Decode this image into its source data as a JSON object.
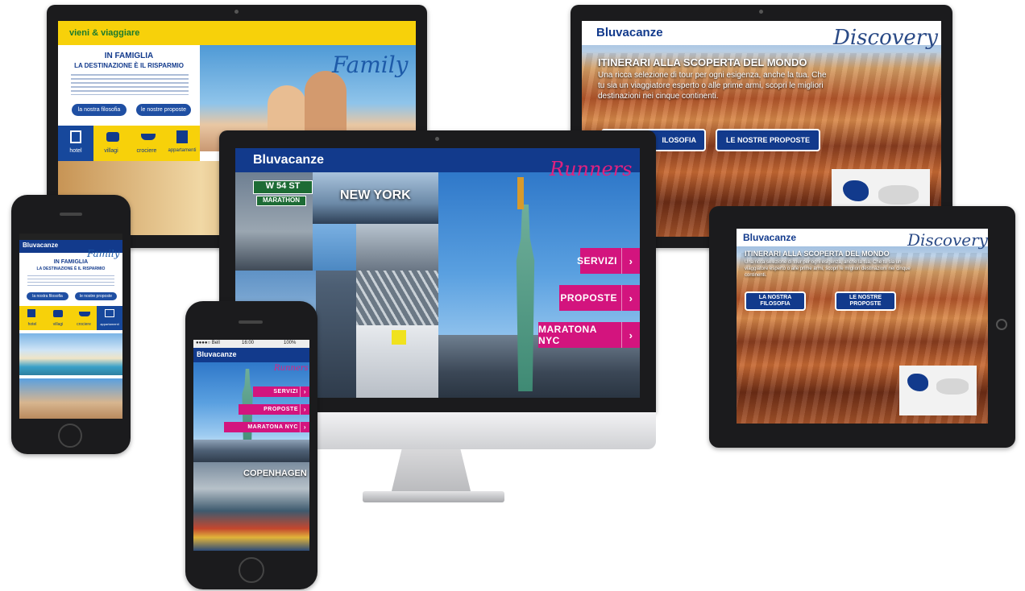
{
  "family_site": {
    "logo": "vieni & viaggiare",
    "brand_script": "Family",
    "headline_1": "IN FAMIGLIA",
    "headline_2": "LA DESTINAZIONE È IL RISPARMIO",
    "btn_left": "la nostra filosofia",
    "btn_right": "le nostre proposte",
    "nav": [
      "hotel",
      "villagi",
      "crociere",
      "appartamenti"
    ]
  },
  "discovery_site": {
    "brand": "Bluvacanze",
    "brand_script": "Discovery",
    "headline": "ITINERARI ALLA SCOPERTA DEL MONDO",
    "body": "Una ricca selezione di tour per ogni esigenza, anche la tua. Che tu sia un viaggiatore esperto o alle prime armi, scopri le migliori destinazioni nei cinque continenti.",
    "btn_left": "LA NOSTRA FILOSOFIA",
    "btn_right": "LE NOSTRE PROPOSTE",
    "btn_left_partial": "ILOSOFIA"
  },
  "runners_site": {
    "brand": "Bluvacanze",
    "brand_script": "Runners",
    "street_sign": "W 54 ST",
    "sub_sign": "MARATHON",
    "city": "NEW YORK",
    "buttons": [
      "SERVIZI",
      "PROPOSTE",
      "MARATONA NYC"
    ]
  },
  "phone_runners": {
    "status_left": "●●●●○ Bell",
    "status_time": "16:00",
    "status_right": "100%",
    "brand": "Bluvacanze",
    "brand_script": "Runners",
    "buttons": [
      "SERVIZI",
      "PROPOSTE",
      "MARATONA NYC"
    ],
    "city": "COPENHAGEN"
  },
  "phone_family": {
    "brand": "Bluvacanze",
    "brand_script": "Family",
    "headline_1": "IN FAMIGLIA",
    "headline_2": "LA DESTINAZIONE È IL RISPARMIO",
    "btn_left": "la nostra filosofia",
    "btn_right": "le nostre proposte",
    "nav": [
      "hotel",
      "villagi",
      "crociere",
      "appartamenti"
    ]
  },
  "tablet_discovery": {
    "brand": "Bluvacanze",
    "brand_script": "Discovery",
    "headline": "ITINERARI ALLA SCOPERTA DEL MONDO",
    "body": "Una ricca selezione di tour per ogni esigenza, anche la tua. Che tu sia un viaggiatore esperto o alle prime armi, scopri le migliori destinazioni nei cinque continenti.",
    "btn_left_1": "LA NOSTRA",
    "btn_left_2": "FILOSOFIA",
    "btn_right_1": "LE NOSTRE",
    "btn_right_2": "PROPOSTE"
  },
  "colors": {
    "navy": "#123a8c",
    "pink": "#d3147e",
    "yellow": "#f7d10a",
    "bezel": "#1b1b1d"
  },
  "icons": [
    "hotel-icon",
    "village-icon",
    "cruise-icon",
    "apartment-icon",
    "chevron-right-icon",
    "world-map-icon"
  ]
}
